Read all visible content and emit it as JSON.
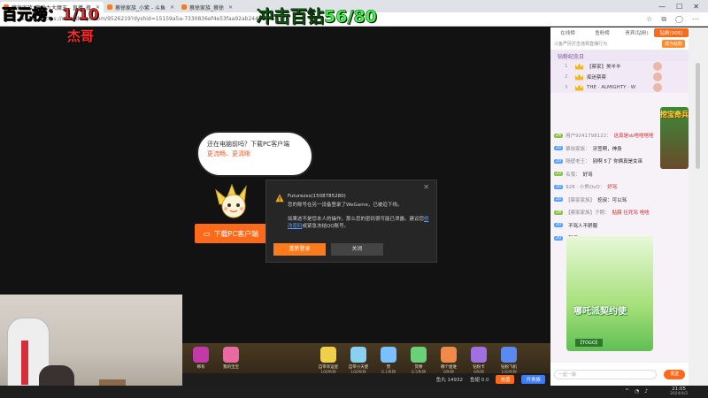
{
  "overlays": {
    "rank": "百元榜：1/10",
    "name": "杰哥",
    "goal": "冲击百钻56/80"
  },
  "browser": {
    "tabs": [
      {
        "label": "蔡徐家族_蔡徐九大魔王 - 直播_夜"
      },
      {
        "label": "蔡徐家族_小紫 - 斗鱼"
      },
      {
        "label": "蔡徐家族_蔡徐"
      }
    ],
    "url": "https://www.douyu.com/9526219?dyshid=15159a5a-7330836ef4e53faa92ab244500051701"
  },
  "player": {
    "bubble_line1": "还在电脑前吗？下载PC客户端",
    "bubble_line2": "更流畅、更清晰",
    "download_label": "下载PC客户端",
    "dialog": {
      "title": "Futurezxs(1508785280)",
      "message1": "您的账号在另一设备登录了WeGame，已被迫下线。",
      "message2_pre": "如果这不是您本人的操作，那么您的密码很可能已泄露。建议您",
      "message2_link": "修改密码",
      "message2_post": "或紧急冻结QQ账号。",
      "btn_relogin": "重新登录",
      "btn_close": "关闭"
    }
  },
  "gifts": [
    {
      "name": "稀有",
      "price": "100鱼翅"
    },
    {
      "name": "我的宝宝",
      "price": "100鱼翅"
    },
    {
      "name": "自带幸运星",
      "price": "100鱼翅"
    },
    {
      "name": "自带小天使",
      "price": "100鱼翅"
    },
    {
      "name": "赞",
      "price": "0.1鱼翅"
    },
    {
      "name": "荧棒",
      "price": "0.5鱼翅"
    },
    {
      "name": "哪个姐谁",
      "price": "6鱼翅"
    },
    {
      "name": "钻粉卡",
      "price": "6鱼翅"
    },
    {
      "name": "钻粉飞机",
      "price": "100鱼翅"
    }
  ],
  "bottombar": {
    "yuwan": "鱼丸 14932",
    "yuchi": "鱼翅 0.0",
    "btn_charge": "充值",
    "btn_noble": "开贵族"
  },
  "rpanel": {
    "tabs": [
      "在线榜",
      "鱼粉榜",
      "贵宾(钻粉)",
      "钻粉(905)"
    ],
    "notice": "斗鱼严厉打击违规直播行为",
    "notice_badge": "成为钻粉",
    "rank_title": "钻粉纪念日",
    "rank_rows": [
      {
        "n": "1",
        "name": "【蔡家】美羊羊"
      },
      {
        "n": "2",
        "name": "痴迷蔡蔡"
      },
      {
        "n": "3",
        "name": "THE · ALMIGHTY · W"
      }
    ],
    "messages": [
      {
        "lv": "24",
        "name": "用户9241798122：",
        "text": "这真是sb啥啥啥啥",
        "hl": true
      },
      {
        "lv": "20",
        "name": "蔡徐家族：",
        "text": "牙签啊，神身",
        "hl": false
      },
      {
        "lv": "20",
        "name": "隔壁老王：",
        "text": "别啊 5了 你俩真是女巫",
        "hl": false
      },
      {
        "lv": "23",
        "name": "名我：",
        "text": "好骂",
        "hl": false
      },
      {
        "lv": "20",
        "name": "928 · 小熊OvO：",
        "text": "好骂",
        "hl": true
      },
      {
        "lv": "20",
        "name": "【蔡家家族】",
        "text": "挖叔：可以骂",
        "hl": false
      },
      {
        "lv": "24",
        "name": "【蔡家家族】子期：",
        "text": "贴膜 往死骂 啥啥",
        "hl": true
      },
      {
        "lv": "20",
        "name": "",
        "text": "不骂人不舒服",
        "hl": false
      },
      {
        "lv": "20",
        "name": "",
        "text": "就了",
        "hl": false
      }
    ],
    "promo_title": "哪吒派契约使",
    "promo_tag": "【TOGO】",
    "treasure_text": "挖宝奇兵",
    "input_placeholder": "一起一聊",
    "send_label": "发送"
  },
  "taskbar": {
    "time": "21:05",
    "date": "2024/4/2"
  }
}
